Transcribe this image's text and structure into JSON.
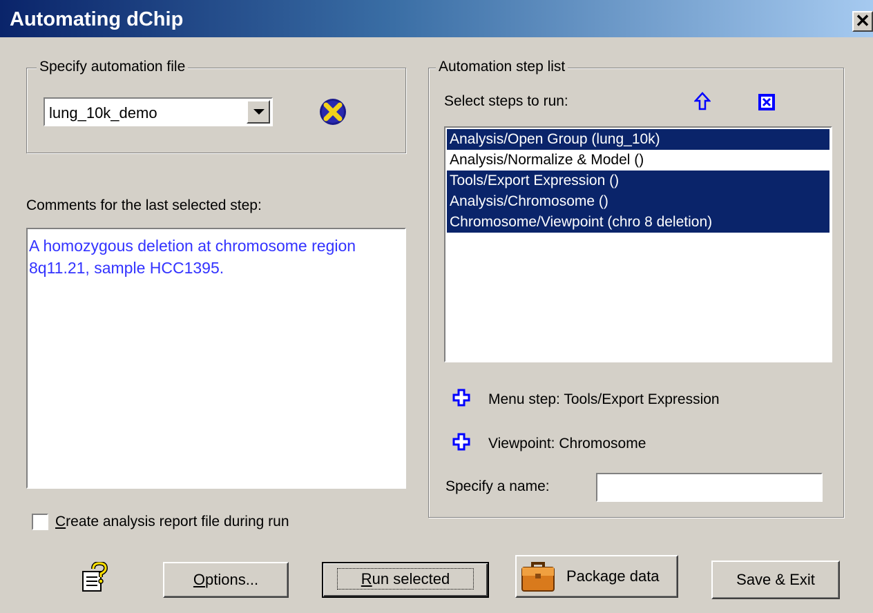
{
  "window": {
    "title": "Automating dChip",
    "close_glyph": "✕"
  },
  "file_group": {
    "label": "Specify automation file",
    "combo_value": "lung_10k_demo",
    "clear_icon": "yellow-x-delete-icon"
  },
  "comments": {
    "label": "Comments for the last selected step:",
    "text": "A homozygous deletion at chromosome region 8q11.21, sample HCC1395.",
    "text_color": "#3333ff"
  },
  "report_checkbox": {
    "label_first": "C",
    "label_rest": "reate analysis report file during run",
    "checked": false
  },
  "steps_group": {
    "label": "Automation step list",
    "select_label": "Select steps to run:",
    "move_up_icon": "up-arrow-icon",
    "delete_icon": "delete-step-icon",
    "items": [
      {
        "label": "Analysis/Open Group (lung_10k)",
        "selected": true
      },
      {
        "label": "Analysis/Normalize & Model ()",
        "selected": false
      },
      {
        "label": "Tools/Export Expression ()",
        "selected": true
      },
      {
        "label": "Analysis/Chromosome ()",
        "selected": true
      },
      {
        "label": "Chromosome/Viewpoint (chro 8 deletion)",
        "selected": true
      }
    ],
    "add_menu_step": "Menu step: Tools/Export Expression",
    "add_viewpoint": "Viewpoint: Chromosome",
    "name_label": "Specify a name:",
    "name_value": ""
  },
  "buttons": {
    "help_icon": "help-question-icon",
    "options_first": "O",
    "options_rest": "ptions...",
    "run_first": "R",
    "run_rest": "un selected",
    "package": "Package data",
    "package_icon": "briefcase-icon",
    "save_exit": "Save & Exit"
  },
  "colors": {
    "selection": "#0a246a",
    "accent_blue": "#0000ff",
    "face": "#d4d0c8"
  }
}
